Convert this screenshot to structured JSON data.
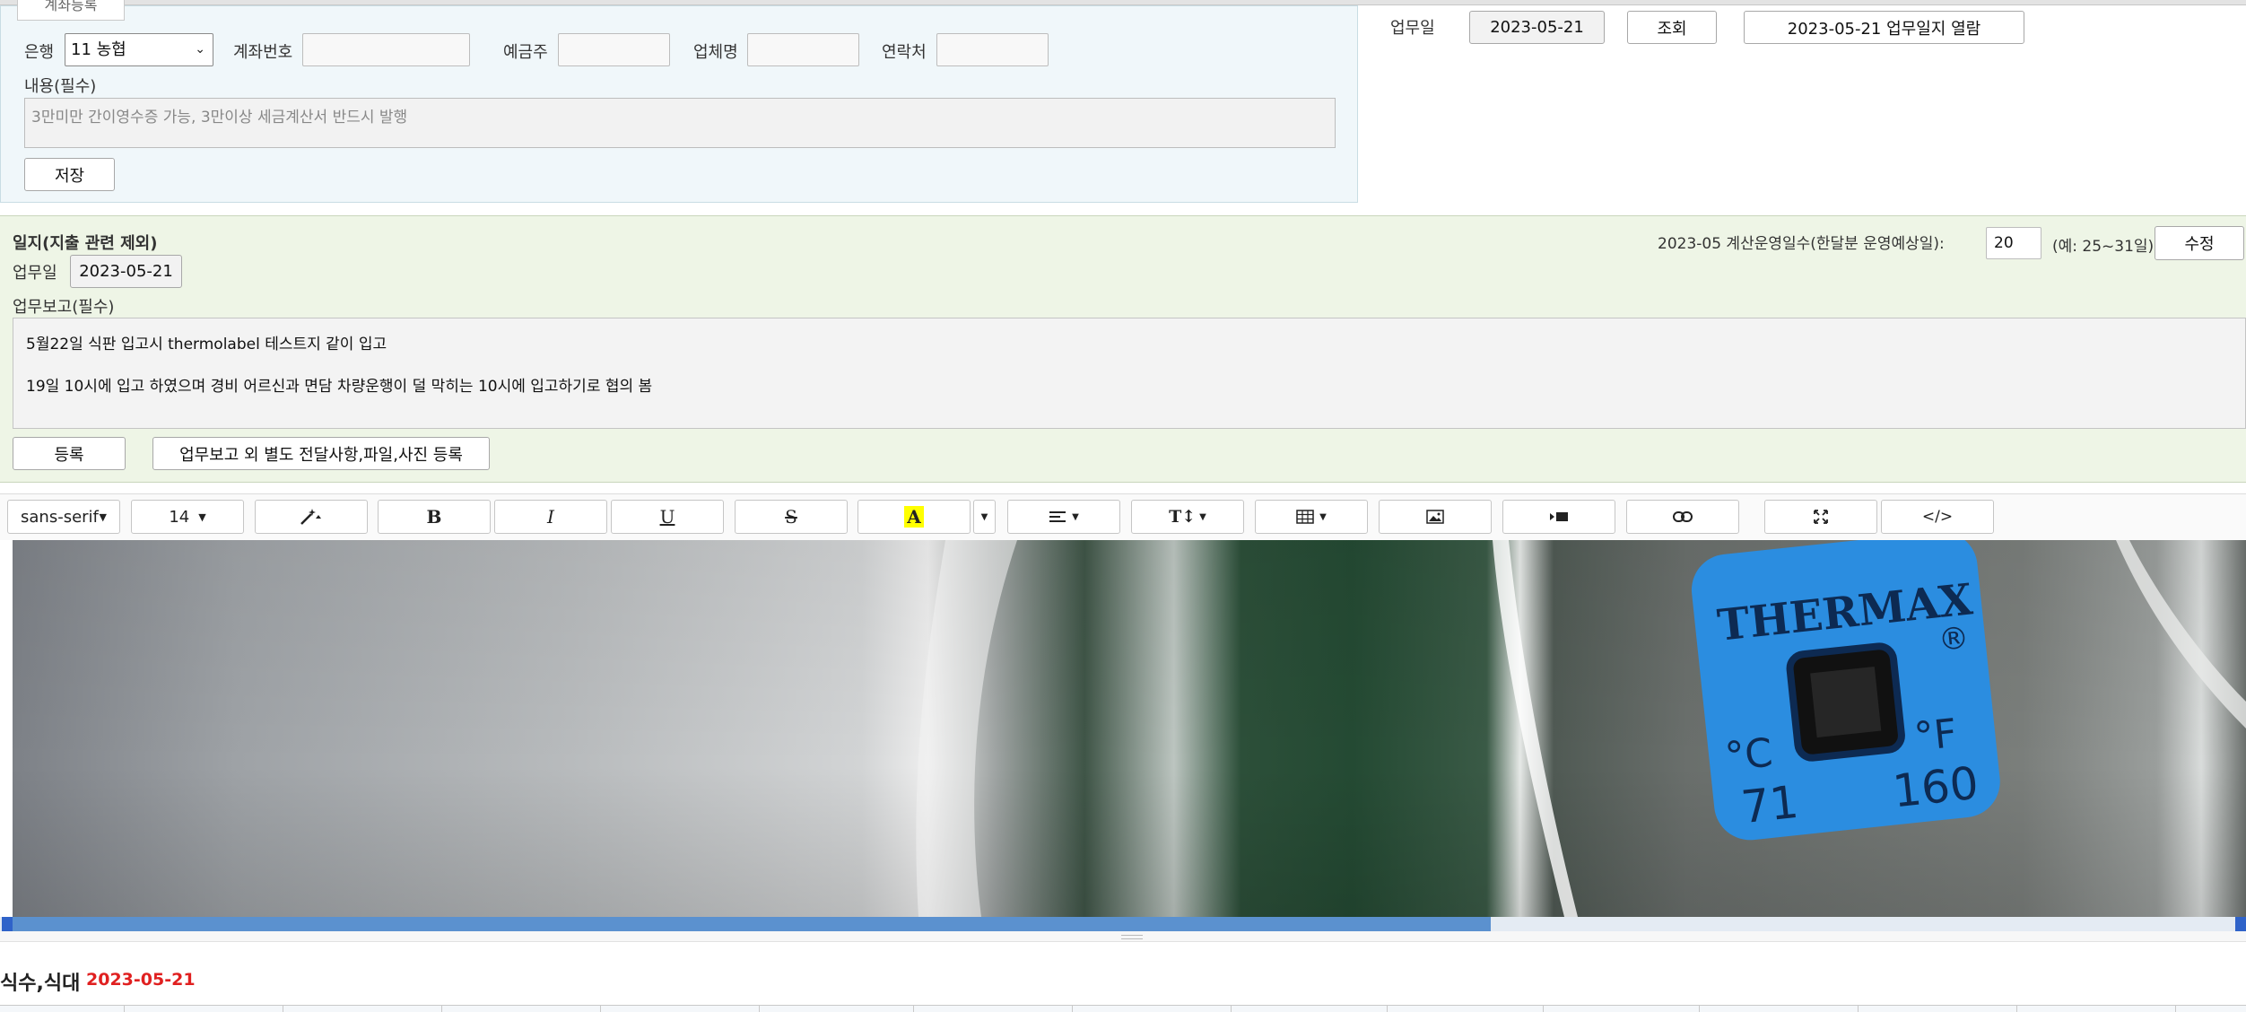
{
  "expense_form": {
    "tab_label": "계좌등록",
    "bank_label": "은행",
    "bank_selected": "11 농협",
    "account_label": "계좌번호",
    "account_value": "",
    "holder_label": "예금주",
    "holder_value": "",
    "company_label": "업체명",
    "company_value": "",
    "contact_label": "연락처",
    "contact_value": "",
    "content_label": "내용(필수)",
    "content_placeholder": "3만미만 간이영수증 가능, 3만이상 세금계산서 반드시 발행",
    "save_button": "저장"
  },
  "work_date_bar": {
    "label": "업무일",
    "date": "2023-05-21",
    "search_button": "조회",
    "view_journal_button": "2023-05-21 업무일지 열람"
  },
  "journal": {
    "title": "일지(지출 관련 제외)",
    "operating_days_label": "2023-05 계산운영일수(한달분 운영예상일):",
    "operating_days_value": "20",
    "operating_days_hint": "(예: 25~31일)",
    "edit_button": "수정",
    "work_date_label": "업무일",
    "work_date_value": "2023-05-21",
    "report_label": "업무보고(필수)",
    "report_lines": [
      "5월22일 식판 입고시 thermolabel 테스트지 같이 입고",
      "19일 10시에 입고 하였으며 경비 어르신과 면담 차량운행이 덜 막히는 10시에 입고하기로 협의 봄"
    ],
    "register_button": "등록",
    "extra_register_button": "업무보고 외 별도 전달사항,파일,사진 등록"
  },
  "editor_toolbar": {
    "font_family": "sans-serif",
    "font_size": "14",
    "tools": [
      "magic-icon",
      "bold-icon",
      "italic-icon",
      "underline-icon",
      "strikethrough-icon",
      "highlight-icon",
      "align-icon",
      "text-height-icon",
      "table-icon",
      "image-icon",
      "video-icon",
      "link-icon",
      "fullscreen-icon",
      "code-view-icon"
    ],
    "bold_glyph": "B",
    "italic_glyph": "I",
    "underline_glyph": "U",
    "strike_glyph": "S",
    "highlight_glyph": "A",
    "code_glyph": "</>",
    "highlight_color": "#ffff00"
  },
  "editor_image": {
    "label_brand": "THERMAX",
    "label_registered": "®",
    "unit_c": "°C",
    "unit_f": "°F",
    "temp_c": "71",
    "temp_f": "160",
    "label_color": "#2b8de0"
  },
  "meals": {
    "title": "식수,식대",
    "date": "2023-05-21"
  }
}
